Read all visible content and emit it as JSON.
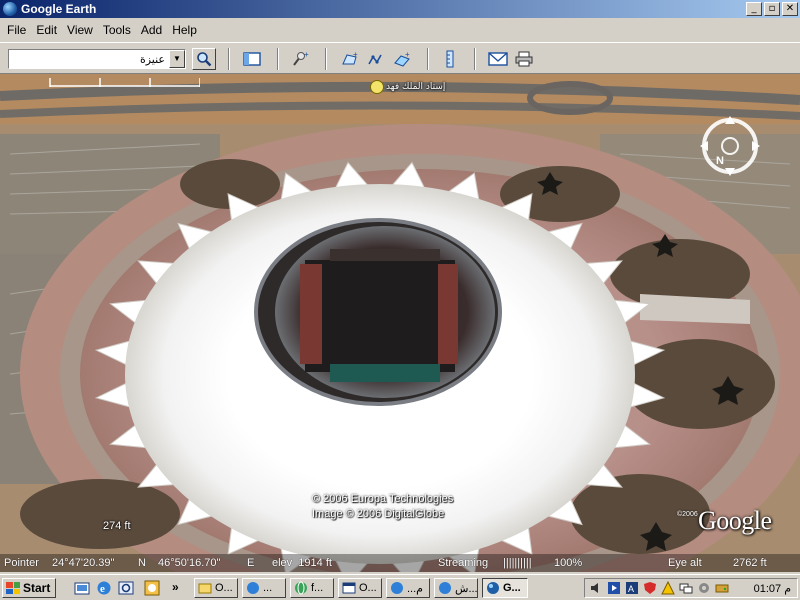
{
  "window": {
    "title": "Google Earth",
    "buttons": [
      "_",
      "▫",
      "✕"
    ]
  },
  "menu": [
    "File",
    "Edit",
    "View",
    "Tools",
    "Add",
    "Help"
  ],
  "toolbar": {
    "search_value": "عنيزة",
    "icons": [
      "search-icon",
      "sidebar-icon",
      "placemark-add-icon",
      "polygon-add-icon",
      "path-add-icon",
      "overlay-add-icon",
      "ruler-icon",
      "email-icon",
      "print-icon"
    ]
  },
  "map": {
    "placemark_label": "إستاد الملك فهد",
    "copyright_line1": "© 2006 Europa Technologies",
    "copyright_line2": "Image © 2006 DigitalGlobe",
    "logo_year": "©2006",
    "logo_text": "Google",
    "scale_label": "274 ft"
  },
  "status": {
    "pointer_label": "Pointer",
    "lat": "24°47'20.39\"",
    "lat_hemi": "N",
    "lon": "46°50'16.70\"",
    "lon_hemi": "E",
    "elev": "elev  1914 ft",
    "streaming_label": "Streaming",
    "streaming_bars": "||||||||||",
    "streaming_percent": "100%",
    "eye_alt_label": "Eye alt",
    "eye_alt_value": "2762 ft"
  },
  "taskbar": {
    "start_label": "Start",
    "chevron": "»",
    "tasks": [
      {
        "label": "O...",
        "icon": "folder-icon"
      },
      {
        "label": "...",
        "icon": "ie-icon"
      },
      {
        "label": "f...",
        "icon": "globe-icon"
      },
      {
        "label": "O...",
        "icon": "window-icon"
      },
      {
        "label": "...م",
        "icon": "ie-icon"
      },
      {
        "label": "ش...",
        "icon": "ie-icon"
      },
      {
        "label": "G...",
        "icon": "google-earth-icon"
      }
    ],
    "clock": "01:07 م"
  },
  "colors": {
    "titlebar_start": "#0a246a",
    "titlebar_end": "#a6caf0",
    "taskbar": "#d4d0c8"
  }
}
